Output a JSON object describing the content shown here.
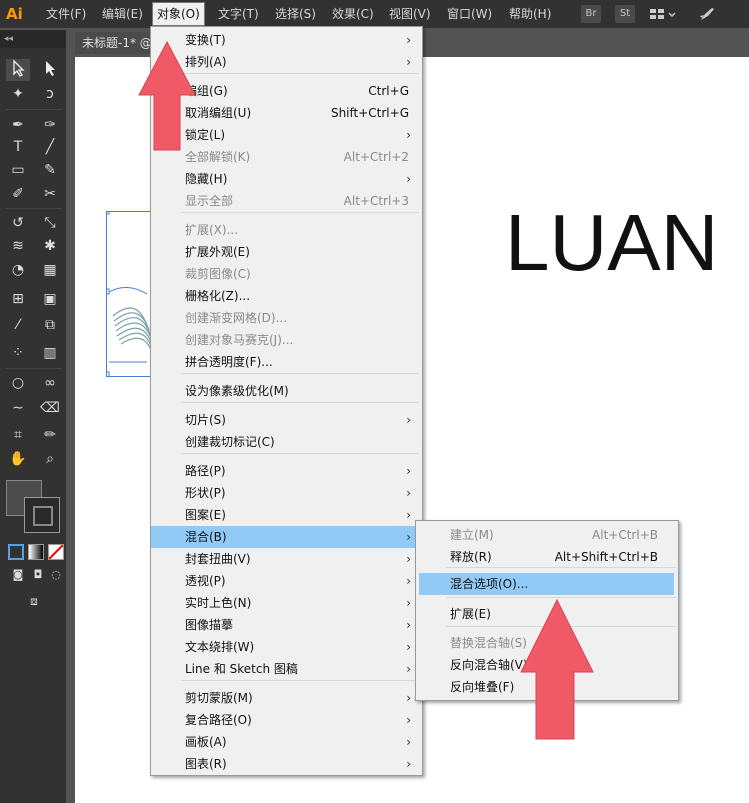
{
  "app": {
    "logo": "Ai"
  },
  "menubar": {
    "items": [
      "文件(F)",
      "编辑(E)",
      "对象(O)",
      "文字(T)",
      "选择(S)",
      "效果(C)",
      "视图(V)",
      "窗口(W)",
      "帮助(H)"
    ],
    "bridge": "Br",
    "stock": "St"
  },
  "document": {
    "tab_title": "未标题-1* @",
    "canvas_text": "LUAN"
  },
  "object_menu": {
    "items": [
      {
        "label": "变换(T)",
        "shortcut": "",
        "submenu": true
      },
      {
        "label": "排列(A)",
        "shortcut": "",
        "submenu": true
      },
      {
        "label": "编组(G)",
        "shortcut": "Ctrl+G",
        "submenu": false
      },
      {
        "label": "取消编组(U)",
        "shortcut": "Shift+Ctrl+G",
        "submenu": false
      },
      {
        "label": "锁定(L)",
        "shortcut": "",
        "submenu": true
      },
      {
        "label": "全部解锁(K)",
        "shortcut": "Alt+Ctrl+2",
        "submenu": false,
        "disabled": true
      },
      {
        "label": "隐藏(H)",
        "shortcut": "",
        "submenu": true
      },
      {
        "label": "显示全部",
        "shortcut": "Alt+Ctrl+3",
        "submenu": false,
        "disabled": true
      },
      {
        "label": "扩展(X)...",
        "shortcut": "",
        "submenu": false,
        "disabled": true
      },
      {
        "label": "扩展外观(E)",
        "shortcut": "",
        "submenu": false
      },
      {
        "label": "裁剪图像(C)",
        "shortcut": "",
        "submenu": false,
        "disabled": true
      },
      {
        "label": "栅格化(Z)...",
        "shortcut": "",
        "submenu": false
      },
      {
        "label": "创建渐变网格(D)...",
        "shortcut": "",
        "submenu": false,
        "disabled": true
      },
      {
        "label": "创建对象马赛克(J)...",
        "shortcut": "",
        "submenu": false,
        "disabled": true
      },
      {
        "label": "拼合透明度(F)...",
        "shortcut": "",
        "submenu": false
      },
      {
        "label": "设为像素级优化(M)",
        "shortcut": "",
        "submenu": false
      },
      {
        "label": "切片(S)",
        "shortcut": "",
        "submenu": true
      },
      {
        "label": "创建裁切标记(C)",
        "shortcut": "",
        "submenu": false
      },
      {
        "label": "路径(P)",
        "shortcut": "",
        "submenu": true
      },
      {
        "label": "形状(P)",
        "shortcut": "",
        "submenu": true
      },
      {
        "label": "图案(E)",
        "shortcut": "",
        "submenu": true
      },
      {
        "label": "混合(B)",
        "shortcut": "",
        "submenu": true,
        "highlighted": true
      },
      {
        "label": "封套扭曲(V)",
        "shortcut": "",
        "submenu": true
      },
      {
        "label": "透视(P)",
        "shortcut": "",
        "submenu": true
      },
      {
        "label": "实时上色(N)",
        "shortcut": "",
        "submenu": true
      },
      {
        "label": "图像描摹",
        "shortcut": "",
        "submenu": true
      },
      {
        "label": "文本绕排(W)",
        "shortcut": "",
        "submenu": true
      },
      {
        "label": "Line 和 Sketch 图稿",
        "shortcut": "",
        "submenu": true
      },
      {
        "label": "剪切蒙版(M)",
        "shortcut": "",
        "submenu": true
      },
      {
        "label": "复合路径(O)",
        "shortcut": "",
        "submenu": true
      },
      {
        "label": "画板(A)",
        "shortcut": "",
        "submenu": true
      },
      {
        "label": "图表(R)",
        "shortcut": "",
        "submenu": true
      }
    ]
  },
  "blend_submenu": {
    "items": [
      {
        "label": "建立(M)",
        "shortcut": "Alt+Ctrl+B",
        "disabled": true
      },
      {
        "label": "释放(R)",
        "shortcut": "Alt+Shift+Ctrl+B"
      },
      {
        "label": "混合选项(O)...",
        "shortcut": "",
        "highlighted": true
      },
      {
        "label": "扩展(E)",
        "shortcut": ""
      },
      {
        "label": "替换混合轴(S)",
        "shortcut": "",
        "disabled": true
      },
      {
        "label": "反向混合轴(V)",
        "shortcut": ""
      },
      {
        "label": "反向堆叠(F)",
        "shortcut": ""
      }
    ]
  },
  "colors": {
    "highlight": "#91c9f7",
    "arrow": "#f05a66",
    "menubar": "#323232",
    "selection": "#4a7bd6"
  }
}
